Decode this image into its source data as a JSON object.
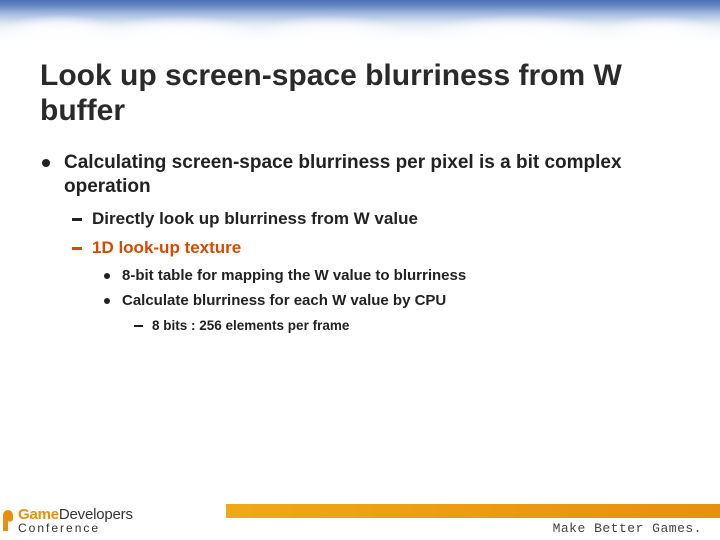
{
  "title": "Look up screen-space blurriness from W buffer",
  "bullets": {
    "l1": "Calculating screen-space blurriness per pixel is a bit complex operation",
    "l2a": "Directly look up blurriness from W value",
    "l2b": "1D look-up texture",
    "l3a": "8-bit table for mapping the W value to blurriness",
    "l3b": "Calculate blurriness for each W value by CPU",
    "l4a": "8 bits : 256 elements per frame"
  },
  "footer": {
    "logo_game": "Game",
    "logo_dev": "Developers",
    "logo_conf": "Conference",
    "tagline": "Make Better Games."
  }
}
